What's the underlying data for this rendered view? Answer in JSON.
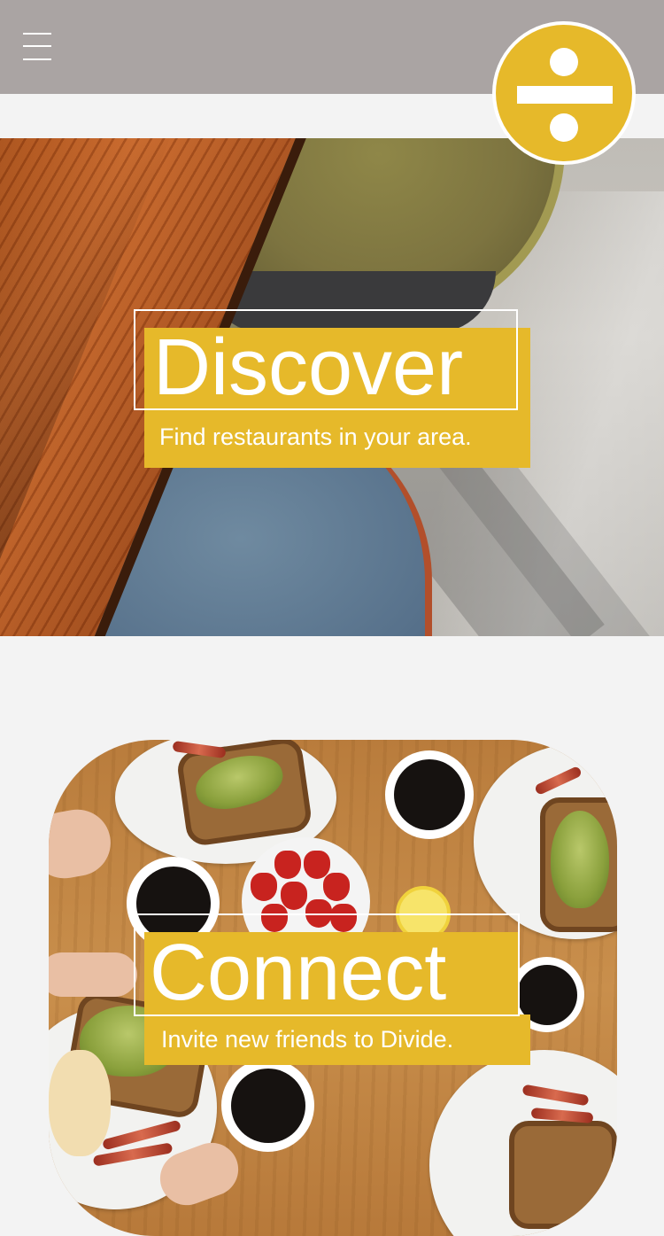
{
  "header": {
    "menu_icon": "hamburger-menu-icon",
    "logo_icon": "divide-sign-logo-icon",
    "colors": {
      "bar": "#aaa4a3",
      "accent": "#e6b92a"
    }
  },
  "sections": [
    {
      "id": "discover",
      "title": "Discover",
      "subtitle": "Find restaurants in your area."
    },
    {
      "id": "connect",
      "title": "Connect",
      "subtitle": "Invite new friends to Divide."
    }
  ]
}
